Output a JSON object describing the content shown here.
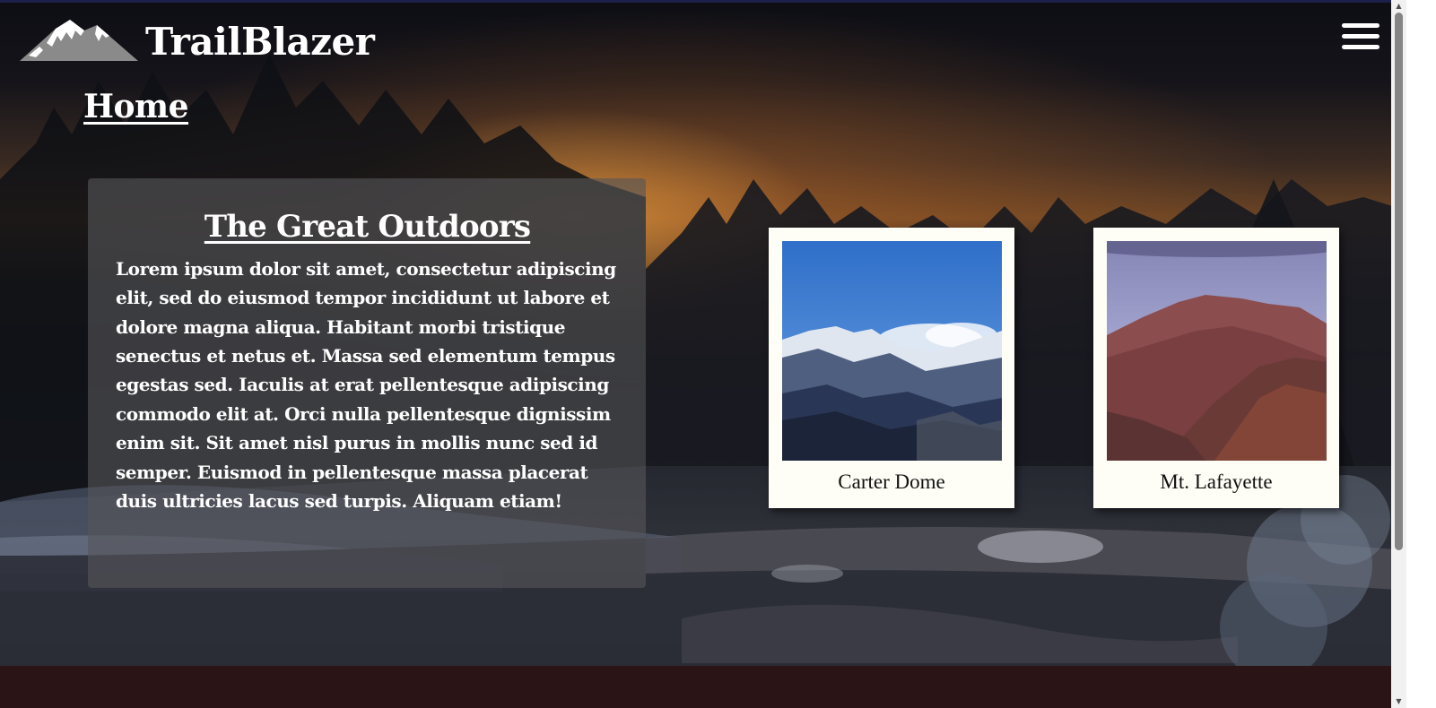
{
  "header": {
    "brand_name": "TrailBlazer",
    "logo_icon": "mountain-logo-icon",
    "menu_icon": "hamburger-menu-icon"
  },
  "page": {
    "heading": "Home"
  },
  "intro": {
    "title": "The Great Outdoors",
    "body": "Lorem ipsum dolor sit amet, consectetur adipiscing elit, sed do eiusmod tempor incididunt ut labore et dolore magna aliqua. Habitant morbi tristique senectus et netus et. Massa sed elementum tempus egestas sed. Iaculis at erat pellentesque adipiscing commodo elit at. Orci nulla pellentesque dignissim enim sit. Sit amet nisl purus in mollis nunc sed id semper. Euismod in pellentesque massa placerat duis ultricies lacus sed turpis. Aliquam etiam!"
  },
  "gallery": [
    {
      "caption": "Carter Dome"
    },
    {
      "caption": "Mt. Lafayette"
    }
  ],
  "colors": {
    "card_background": "#fefef6",
    "footer": "#2a1416",
    "text": "#ffffff"
  }
}
